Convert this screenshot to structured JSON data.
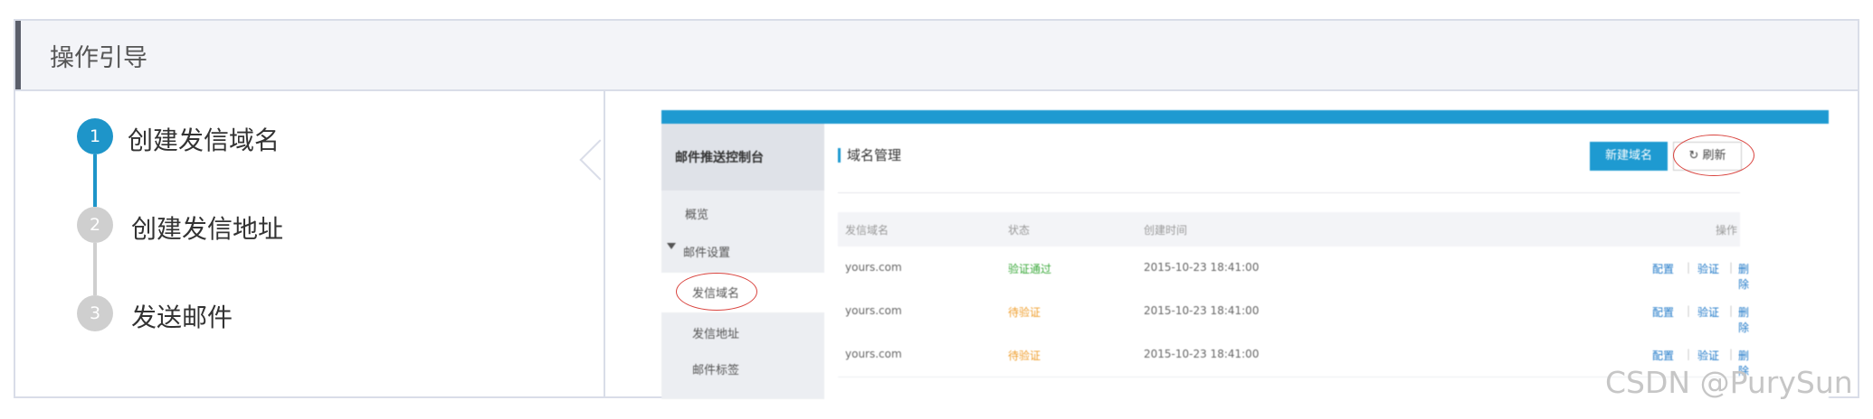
{
  "header": {
    "title": "操作引导"
  },
  "steps": [
    {
      "number": "1",
      "label": "创建发信域名",
      "active": true
    },
    {
      "number": "2",
      "label": "创建发信地址",
      "active": false
    },
    {
      "number": "3",
      "label": "发送邮件",
      "active": false
    }
  ],
  "console": {
    "sidebar": {
      "title": "邮件推送控制台",
      "items": [
        {
          "label": "概览"
        },
        {
          "label": "邮件设置"
        },
        {
          "label": "发信域名"
        },
        {
          "label": "发信地址"
        },
        {
          "label": "邮件标签"
        }
      ]
    },
    "main": {
      "title": "域名管理",
      "new_button": "新建域名",
      "refresh_button": "刷新",
      "columns": [
        "发信域名",
        "状态",
        "创建时间",
        "操作"
      ],
      "rows": [
        {
          "domain": "yours.com",
          "status": "验证通过",
          "created": "2015-10-23 18:41:00",
          "ops": [
            "配置",
            "验证",
            "删除"
          ]
        },
        {
          "domain": "yours.com",
          "status": "待验证",
          "created": "2015-10-23 18:41:00",
          "ops": [
            "配置",
            "验证",
            "删除"
          ]
        },
        {
          "domain": "yours.com",
          "status": "待验证",
          "created": "2015-10-23 18:41:00",
          "ops": [
            "配置",
            "验证",
            "删除"
          ]
        }
      ]
    }
  },
  "colors": {
    "accent": "#1e9ad1",
    "ok": "#3aa93a",
    "pending": "#f0a030",
    "highlight": "#d9443f"
  },
  "icons": {
    "refresh": "refresh-icon",
    "expand": "triangle-down-icon"
  },
  "watermark": "CSDN @PurySun"
}
